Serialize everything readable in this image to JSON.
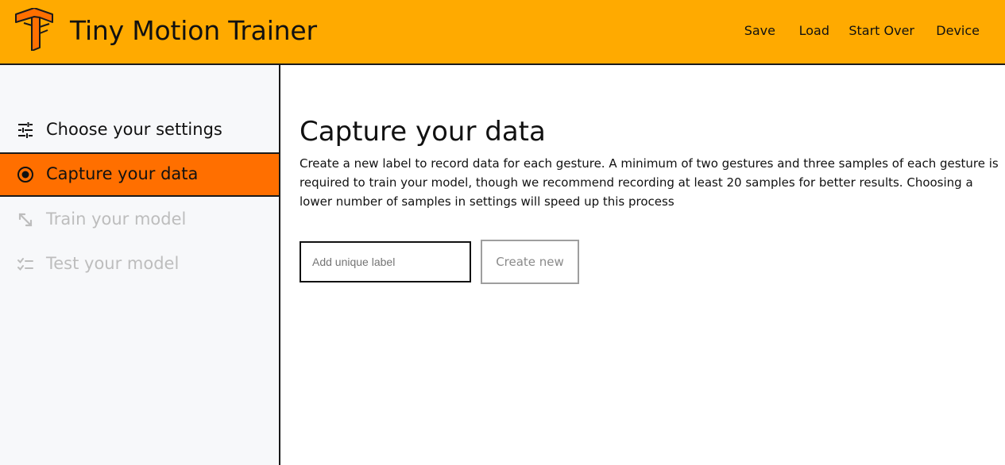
{
  "header": {
    "title": "Tiny Motion Trainer",
    "logo_icon": "tensorflow-logo-icon",
    "nav": [
      "Save",
      "Load",
      "Start Over",
      "Device"
    ],
    "accent_color": "#FFAA00"
  },
  "sidebar": {
    "steps": [
      {
        "label": "Choose your settings",
        "icon": "tune-sliders-icon",
        "state": "done"
      },
      {
        "label": "Capture your data",
        "icon": "radio-target-icon",
        "state": "active"
      },
      {
        "label": "Train your model",
        "icon": "expand-arrows-icon",
        "state": "disabled"
      },
      {
        "label": "Test your model",
        "icon": "checklist-icon",
        "state": "disabled"
      }
    ],
    "active_color": "#FF6F00"
  },
  "main": {
    "title": "Capture your data",
    "description": "Create a new label to record data for each gesture. A minimum of two gestures and three samples of each gesture is required to train your model, though we recommend recording at least 20 samples for better results. Choosing a lower number of samples in settings will speed up this process",
    "label_input": {
      "value": "",
      "placeholder": "Add unique label"
    },
    "create_button": "Create new"
  }
}
